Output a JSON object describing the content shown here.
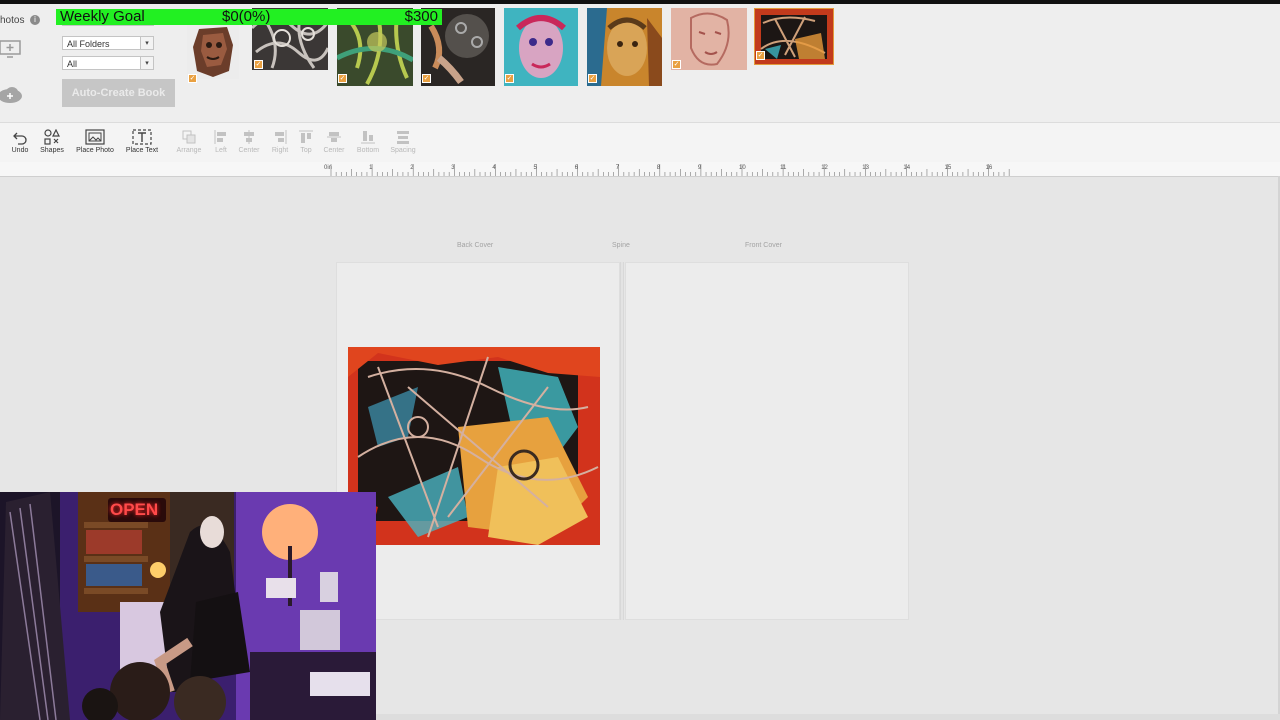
{
  "photos_panel": {
    "label": "hotos",
    "info_icon": "i",
    "folder_select": "All Folders",
    "filter_select": "All",
    "auto_create_button": "Auto-Create Book"
  },
  "weekly_goal": {
    "label": "Weekly Goal",
    "progress_text": "$0(0%)",
    "target": "$300",
    "progress_fraction": 0.0,
    "color": "#22f022"
  },
  "thumbnails_count_visible": 8,
  "toolbar": {
    "undo": "Undo",
    "shapes": "Shapes",
    "place_photo": "Place Photo",
    "place_text": "Place Text",
    "arrange": "Arrange",
    "left": "Left",
    "center_h": "Center",
    "right": "Right",
    "top": "Top",
    "center_v": "Center",
    "bottom": "Bottom",
    "spacing": "Spacing"
  },
  "ruler": {
    "unit_label": "0in",
    "ticks": [
      "1",
      "2",
      "3",
      "4",
      "5",
      "6",
      "7",
      "8",
      "9",
      "10",
      "11",
      "12",
      "13",
      "14",
      "15",
      "16"
    ]
  },
  "canvas": {
    "back_cover": "Back Cover",
    "spine": "Spine",
    "front_cover": "Front Cover"
  },
  "webcam": {
    "open_sign": "OPEN"
  },
  "colors": {
    "accent_check": "#e9a041",
    "goal_bar": "#22f022"
  }
}
